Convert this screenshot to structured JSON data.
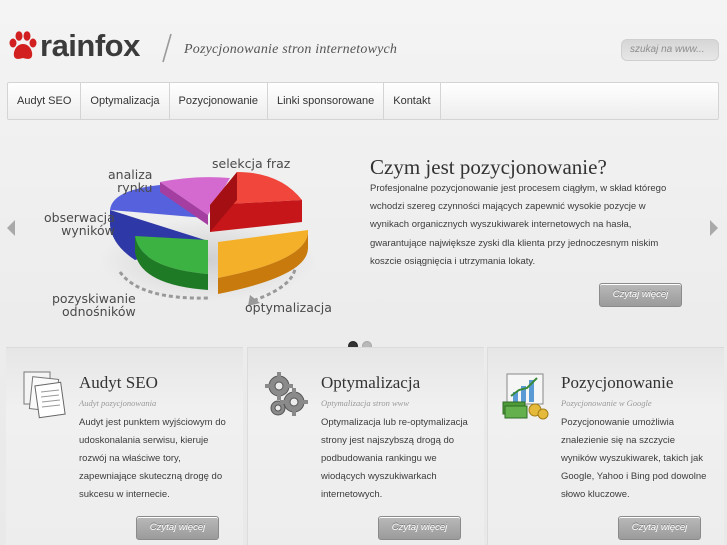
{
  "header": {
    "logo_text": "rainfox",
    "tagline": "Pozycjonowanie stron internetowych",
    "search_placeholder": "szukaj na www..."
  },
  "nav": {
    "items": [
      "Audyt SEO",
      "Optymalizacja",
      "Pozycjonowanie",
      "Linki sponsorowane",
      "Kontakt"
    ]
  },
  "slider": {
    "diagram_labels": {
      "selekcja": "selekcja fraz",
      "analiza": "analiza\nrynku",
      "obserwacja": "obserwacja\nwyników",
      "pozyskiwanie": "pozyskiwanie\nodnośników",
      "optymalizacja": "optymalizacja"
    },
    "title": "Czym jest pozycjonowanie?",
    "text": "Profesjonalne pozycjonowanie jest procesem ciągłym, w skład którego wchodzi szereg czynności mających zapewnić wysokie pozycje w wynikach organicznych wyszukiwarek internetowych na hasła, gwarantujące największe zyski dla klienta przy jednoczesnym niskim koszcie osiągnięcia i utrzymania lokaty.",
    "button": "Czytaj więcej",
    "active_slide": 1,
    "slide_count": 2
  },
  "columns": [
    {
      "icon": "documents-icon",
      "title": "Audyt SEO",
      "subtitle": "Audyt pozycjonowania",
      "text": "Audyt jest punktem wyjściowym do udoskonalania serwisu, kieruje rozwój na właściwe tory, zapewniające skuteczną drogę do sukcesu w internecie.",
      "button": "Czytaj więcej"
    },
    {
      "icon": "gears-icon",
      "title": "Optymalizacja",
      "subtitle": "Optymalizacja stron www",
      "text": "Optymalizacja lub re-optymalizacja strony jest najszybszą drogą do podbudowania rankingu we wiodących wyszukiwarkach internetowych.",
      "button": "Czytaj więcej"
    },
    {
      "icon": "chart-money-icon",
      "title": "Pozycjonowanie",
      "subtitle": "Pozycjonowanie w Google",
      "text": "Pozycjonowanie umożliwia znalezienie się  na szczycie wyników wyszukiwarek, takich jak Google, Yahoo i Bing pod dowolne słowo kluczowe.",
      "button": "Czytaj więcej"
    }
  ],
  "colors": {
    "logo_red": "#d21f1f",
    "pie_red": "#e0231f",
    "pie_orange": "#f3a21a",
    "pie_green": "#2fa336",
    "pie_blue": "#4a57d6",
    "pie_pink": "#d05bc8"
  }
}
